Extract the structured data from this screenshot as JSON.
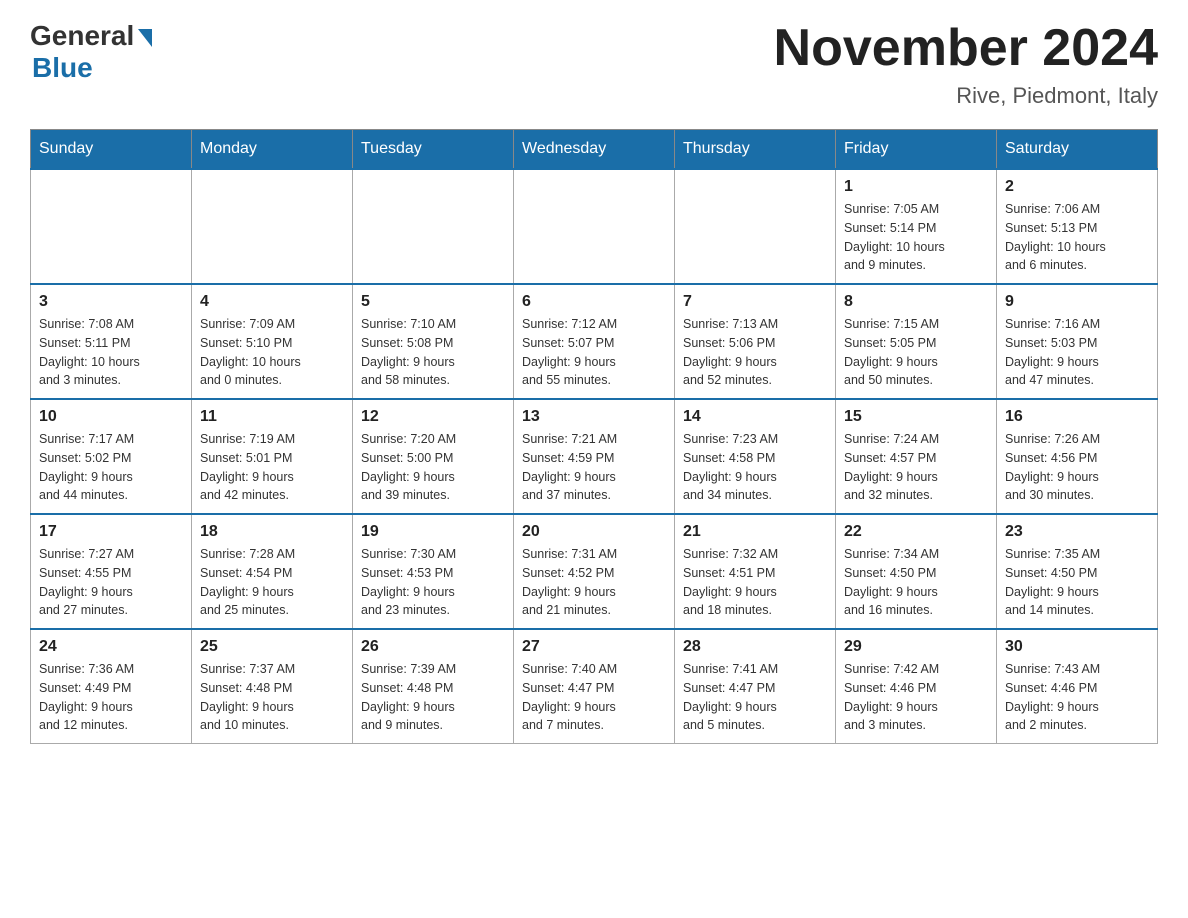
{
  "header": {
    "logo_general": "General",
    "logo_blue": "Blue",
    "month_title": "November 2024",
    "location": "Rive, Piedmont, Italy"
  },
  "weekdays": [
    "Sunday",
    "Monday",
    "Tuesday",
    "Wednesday",
    "Thursday",
    "Friday",
    "Saturday"
  ],
  "weeks": [
    [
      {
        "day": "",
        "info": ""
      },
      {
        "day": "",
        "info": ""
      },
      {
        "day": "",
        "info": ""
      },
      {
        "day": "",
        "info": ""
      },
      {
        "day": "",
        "info": ""
      },
      {
        "day": "1",
        "info": "Sunrise: 7:05 AM\nSunset: 5:14 PM\nDaylight: 10 hours\nand 9 minutes."
      },
      {
        "day": "2",
        "info": "Sunrise: 7:06 AM\nSunset: 5:13 PM\nDaylight: 10 hours\nand 6 minutes."
      }
    ],
    [
      {
        "day": "3",
        "info": "Sunrise: 7:08 AM\nSunset: 5:11 PM\nDaylight: 10 hours\nand 3 minutes."
      },
      {
        "day": "4",
        "info": "Sunrise: 7:09 AM\nSunset: 5:10 PM\nDaylight: 10 hours\nand 0 minutes."
      },
      {
        "day": "5",
        "info": "Sunrise: 7:10 AM\nSunset: 5:08 PM\nDaylight: 9 hours\nand 58 minutes."
      },
      {
        "day": "6",
        "info": "Sunrise: 7:12 AM\nSunset: 5:07 PM\nDaylight: 9 hours\nand 55 minutes."
      },
      {
        "day": "7",
        "info": "Sunrise: 7:13 AM\nSunset: 5:06 PM\nDaylight: 9 hours\nand 52 minutes."
      },
      {
        "day": "8",
        "info": "Sunrise: 7:15 AM\nSunset: 5:05 PM\nDaylight: 9 hours\nand 50 minutes."
      },
      {
        "day": "9",
        "info": "Sunrise: 7:16 AM\nSunset: 5:03 PM\nDaylight: 9 hours\nand 47 minutes."
      }
    ],
    [
      {
        "day": "10",
        "info": "Sunrise: 7:17 AM\nSunset: 5:02 PM\nDaylight: 9 hours\nand 44 minutes."
      },
      {
        "day": "11",
        "info": "Sunrise: 7:19 AM\nSunset: 5:01 PM\nDaylight: 9 hours\nand 42 minutes."
      },
      {
        "day": "12",
        "info": "Sunrise: 7:20 AM\nSunset: 5:00 PM\nDaylight: 9 hours\nand 39 minutes."
      },
      {
        "day": "13",
        "info": "Sunrise: 7:21 AM\nSunset: 4:59 PM\nDaylight: 9 hours\nand 37 minutes."
      },
      {
        "day": "14",
        "info": "Sunrise: 7:23 AM\nSunset: 4:58 PM\nDaylight: 9 hours\nand 34 minutes."
      },
      {
        "day": "15",
        "info": "Sunrise: 7:24 AM\nSunset: 4:57 PM\nDaylight: 9 hours\nand 32 minutes."
      },
      {
        "day": "16",
        "info": "Sunrise: 7:26 AM\nSunset: 4:56 PM\nDaylight: 9 hours\nand 30 minutes."
      }
    ],
    [
      {
        "day": "17",
        "info": "Sunrise: 7:27 AM\nSunset: 4:55 PM\nDaylight: 9 hours\nand 27 minutes."
      },
      {
        "day": "18",
        "info": "Sunrise: 7:28 AM\nSunset: 4:54 PM\nDaylight: 9 hours\nand 25 minutes."
      },
      {
        "day": "19",
        "info": "Sunrise: 7:30 AM\nSunset: 4:53 PM\nDaylight: 9 hours\nand 23 minutes."
      },
      {
        "day": "20",
        "info": "Sunrise: 7:31 AM\nSunset: 4:52 PM\nDaylight: 9 hours\nand 21 minutes."
      },
      {
        "day": "21",
        "info": "Sunrise: 7:32 AM\nSunset: 4:51 PM\nDaylight: 9 hours\nand 18 minutes."
      },
      {
        "day": "22",
        "info": "Sunrise: 7:34 AM\nSunset: 4:50 PM\nDaylight: 9 hours\nand 16 minutes."
      },
      {
        "day": "23",
        "info": "Sunrise: 7:35 AM\nSunset: 4:50 PM\nDaylight: 9 hours\nand 14 minutes."
      }
    ],
    [
      {
        "day": "24",
        "info": "Sunrise: 7:36 AM\nSunset: 4:49 PM\nDaylight: 9 hours\nand 12 minutes."
      },
      {
        "day": "25",
        "info": "Sunrise: 7:37 AM\nSunset: 4:48 PM\nDaylight: 9 hours\nand 10 minutes."
      },
      {
        "day": "26",
        "info": "Sunrise: 7:39 AM\nSunset: 4:48 PM\nDaylight: 9 hours\nand 9 minutes."
      },
      {
        "day": "27",
        "info": "Sunrise: 7:40 AM\nSunset: 4:47 PM\nDaylight: 9 hours\nand 7 minutes."
      },
      {
        "day": "28",
        "info": "Sunrise: 7:41 AM\nSunset: 4:47 PM\nDaylight: 9 hours\nand 5 minutes."
      },
      {
        "day": "29",
        "info": "Sunrise: 7:42 AM\nSunset: 4:46 PM\nDaylight: 9 hours\nand 3 minutes."
      },
      {
        "day": "30",
        "info": "Sunrise: 7:43 AM\nSunset: 4:46 PM\nDaylight: 9 hours\nand 2 minutes."
      }
    ]
  ]
}
